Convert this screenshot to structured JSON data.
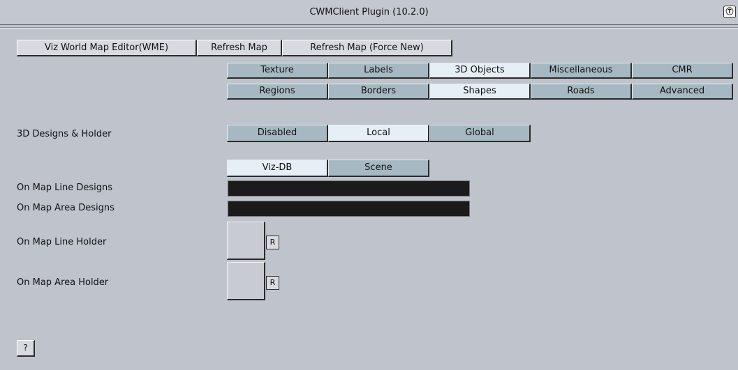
{
  "window": {
    "title": "CWMClient Plugin (10.2.0)",
    "icon": "plugin-icon"
  },
  "toolbar": {
    "wme": "Viz World Map Editor(WME)",
    "refresh": "Refresh Map",
    "refresh_force": "Refresh Map (Force New)"
  },
  "tabs_row1": [
    "Texture",
    "Labels",
    "3D Objects",
    "Miscellaneous",
    "CMR"
  ],
  "tabs_row2": [
    "Regions",
    "Borders",
    "Shapes",
    "Roads",
    "Advanced"
  ],
  "selected_tabs": [
    "3D Objects",
    "Shapes"
  ],
  "designs": {
    "label": "3D Designs & Holder",
    "options": [
      "Disabled",
      "Local",
      "Global"
    ],
    "selected": "Local"
  },
  "source": {
    "options": [
      "Viz-DB",
      "Scene"
    ],
    "selected": "Viz-DB"
  },
  "fields": {
    "line_designs": "On Map Line Designs",
    "area_designs": "On Map Area Designs",
    "line_holder": "On Map Line Holder",
    "area_holder": "On Map Area Holder",
    "reset": "R"
  },
  "help": "?"
}
